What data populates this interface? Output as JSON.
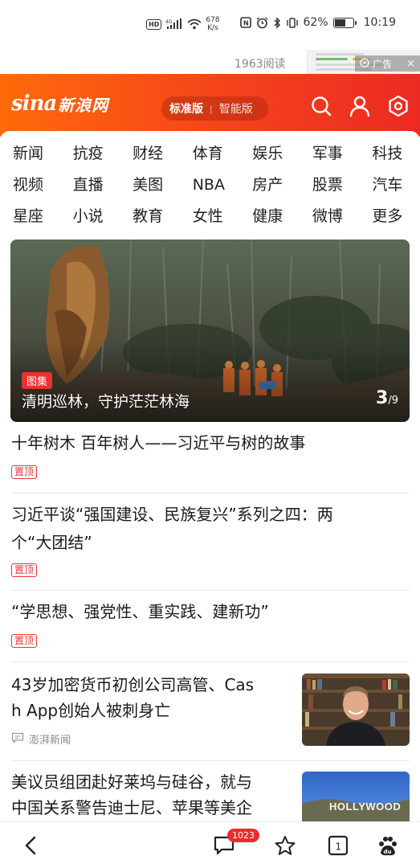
{
  "status_bar": {
    "net_type": "4G",
    "hd_label": "HD",
    "speed_value": "678",
    "speed_unit": "K/s",
    "nfc_label": "N",
    "battery_percent": "62%",
    "battery_level": 0.62,
    "time": "10:19"
  },
  "top_strip": {
    "read_count": "1963阅读",
    "ad_label": "广告",
    "ad_close": "×"
  },
  "header": {
    "logo_latin": "sina",
    "logo_chinese": "新浪网",
    "version_standard": "标准版",
    "version_separator": "|",
    "version_smart": "智能版",
    "icons": [
      "search-icon",
      "user-icon",
      "settings-icon"
    ],
    "gradient_start": "#ff6a0a",
    "gradient_end": "#ec2a23"
  },
  "categories": [
    "新闻",
    "抗疫",
    "财经",
    "体育",
    "娱乐",
    "军事",
    "科技",
    "视频",
    "直播",
    "美图",
    "NBA",
    "房产",
    "股票",
    "汽车",
    "星座",
    "小说",
    "教育",
    "女性",
    "健康",
    "微博",
    "更多"
  ],
  "hero": {
    "tag": "图集",
    "caption": "清明巡林，守护茫茫林海",
    "page_current": "3",
    "page_total": "/9"
  },
  "news": [
    {
      "title": "十年树木 百年树人——习近平与树的故事",
      "pin": "置顶"
    },
    {
      "title_line1": "习近平谈“强国建设、民族复兴”系列之四：两",
      "title_line2": "个“大团结”",
      "pin": "置顶"
    },
    {
      "title": "“学思想、强党性、重实践、建新功”",
      "pin": "置顶"
    },
    {
      "title_line1": "43岁加密货币初创公司高管、Cas",
      "title_line2": "h App创始人被刺身亡",
      "source": "澎湃新闻"
    },
    {
      "title_line1": "美议员组团赴好莱坞与硅谷，就与",
      "title_line2": "中国关系警告迪士尼、苹果等美企",
      "thumb_text": "HOLLYWOOD"
    }
  ],
  "bottom_nav": {
    "comment_count": "1023",
    "tab_count": "1",
    "icons": [
      "back-icon",
      "comment-icon",
      "star-icon",
      "tabs-icon",
      "paw-icon"
    ]
  },
  "colors": {
    "accent_red": "#e8322e",
    "pin_red": "#ee3333"
  }
}
